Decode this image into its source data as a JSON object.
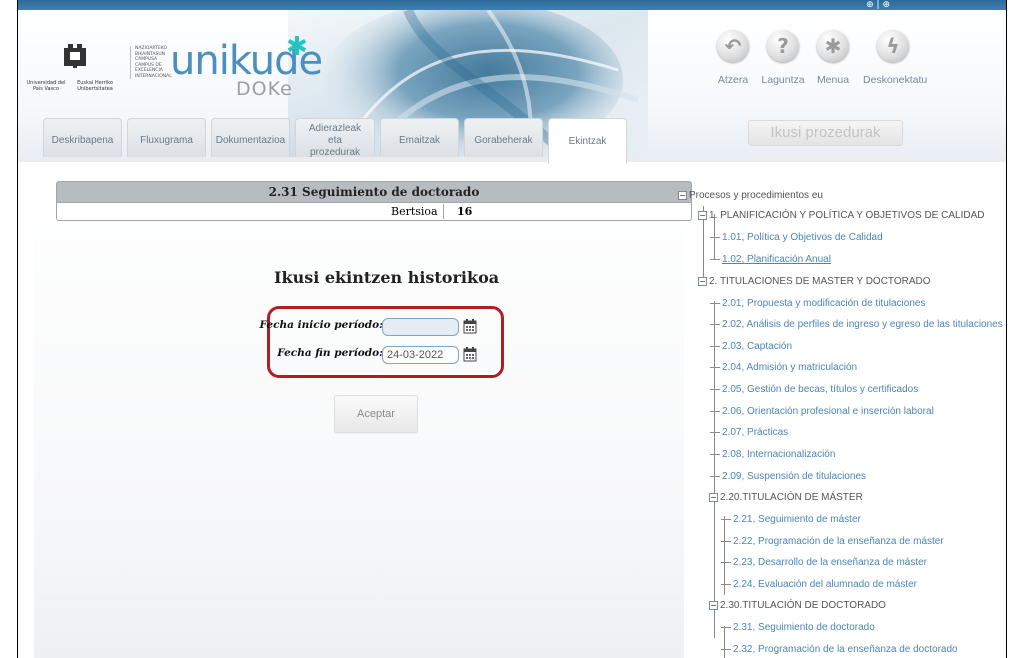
{
  "header": {
    "brand": "unikude",
    "brand_sub": "DOKe",
    "upv_name_left": "Universidad del País Vasco",
    "upv_name_right": "Euskal Herriko Unibertsitatea",
    "campus_text": "NAZIOARTEKO BIKAINTASUN CAMPUSA CAMPUS DE EXCELENCIA INTERNACIONAL",
    "top_icons": "⊕ | ⊕"
  },
  "toolbar": {
    "items": [
      {
        "label": "Atzera",
        "icon": "back-arrow-icon",
        "glyph": "↶"
      },
      {
        "label": "Laguntza",
        "icon": "help-icon",
        "glyph": "?"
      },
      {
        "label": "Menua",
        "icon": "menu-asterisk-icon",
        "glyph": "✱"
      },
      {
        "label": "Deskonektatu",
        "icon": "disconnect-bolt-icon",
        "glyph": "ϟ"
      }
    ],
    "search_button": "Ikusi prozedurak"
  },
  "tabs": [
    {
      "label": "Deskribapena"
    },
    {
      "label": "Fluxugrama"
    },
    {
      "label": "Dokumentazioa"
    },
    {
      "label": "Adierazleak eta prozedurak"
    },
    {
      "label": "Emaitzak"
    },
    {
      "label": "Gorabeherak"
    },
    {
      "label": "Ekintzak",
      "active": true
    }
  ],
  "main": {
    "title": "2.31 Seguimiento de doctorado",
    "version_label": "Bertsioa",
    "version_value": "16",
    "history_title": "Ikusi ekintzen historikoa",
    "form": {
      "start_label": "Fecha inicio período:",
      "start_value": "",
      "end_label": "Fecha fin período:",
      "end_value": "24-03-2022"
    },
    "accept_button": "Aceptar"
  },
  "tree": {
    "root": "Procesos y procedimientos eu",
    "nodes": [
      {
        "label": "1. PLANIFICACIÓN Y POLÍTICA Y OBJETIVOS DE CALIDAD"
      },
      {
        "label": "1.01, Política y Objetivos de Calidad"
      },
      {
        "label": "1.02, Planificación Anual"
      },
      {
        "label": "2. TITULACIONES DE MASTER Y DOCTORADO"
      },
      {
        "label": "2.01, Propuesta y modificación de titulaciones"
      },
      {
        "label": "2.02, Análisis de perfiles de ingreso y egreso de las titulaciones"
      },
      {
        "label": "2.03, Captación"
      },
      {
        "label": "2.04, Admisión y matriculación"
      },
      {
        "label": "2.05, Gestión de becas, títulos y certificados"
      },
      {
        "label": "2.06, Orientación profesional e inserción laboral"
      },
      {
        "label": "2.07, Prácticas"
      },
      {
        "label": "2.08, Internacionalización"
      },
      {
        "label": "2.09, Suspensión de titulaciones"
      },
      {
        "label": "2.20.TITULACIÓN DE MÁSTER"
      },
      {
        "label": "2.21, Seguimiento de máster"
      },
      {
        "label": "2.22, Programación de la enseñanza de máster"
      },
      {
        "label": "2.23, Desarrollo de la enseñanza de máster"
      },
      {
        "label": "2.24, Evaluación del alumnado de máster"
      },
      {
        "label": "2.30.TITULACIÓN DE DOCTORADO"
      },
      {
        "label": "2.31, Seguimiento de doctorado"
      },
      {
        "label": "2.32, Programación de la enseñanza de doctorado"
      }
    ]
  },
  "colors": {
    "accent": "#4a8fc0",
    "highlight_border": "#b01d22",
    "tree_link": "#4c86b4"
  }
}
